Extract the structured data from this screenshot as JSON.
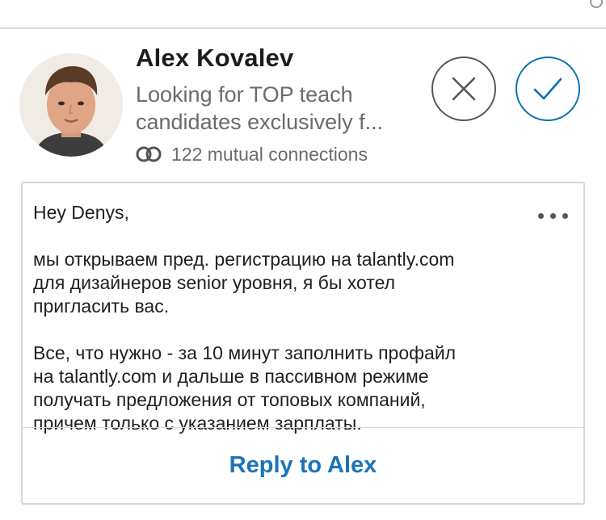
{
  "invitation": {
    "name": "Alex Kovalev",
    "headline_line1": "Looking for TOP teach",
    "headline_line2": "candidates exclusively f...",
    "mutual_connections": "122 mutual connections",
    "avatar_icon": "person-photo",
    "ignore_icon": "close-icon",
    "accept_icon": "checkmark-icon"
  },
  "message": {
    "greeting": "Hey Denys,",
    "para1": [
      "мы открываем пред. регистрацию на talantly.com",
      "для дизайнеров senior уровня, я бы хотел",
      "пригласить вас."
    ],
    "para2": [
      "Все, что нужно - за 10 минут заполнить профайл",
      "на talantly.com и дальше в пассивном режиме",
      "получать предложения от топовых компаний,",
      "причем только с указанием зарплаты."
    ],
    "more_icon": "more-horizontal-icon",
    "reply_label": "Reply to Alex"
  },
  "colors": {
    "accent": "#0a6fb4",
    "reply_text": "#1a73b8",
    "secondary_text": "#6b6b6b",
    "card_border": "#cfd8dc"
  }
}
